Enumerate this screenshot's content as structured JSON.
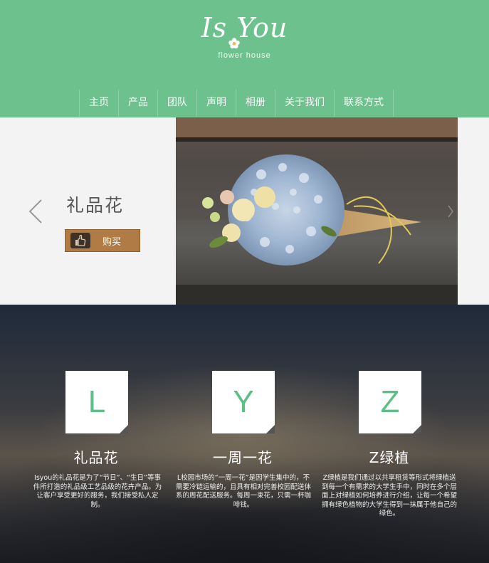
{
  "header": {
    "logo_text": "Is You",
    "logo_sub": "flower  house",
    "nav": [
      "主页",
      "产品",
      "团队",
      "声明",
      "相册",
      "关于我们",
      "联系方式"
    ]
  },
  "banner": {
    "title": "礼品花",
    "buy_label": "购买"
  },
  "features": [
    {
      "letter": "L",
      "title": "礼品花",
      "desc": "Isyou的礼品花是为了“节日”、“生日”等事件所打造的礼品级工艺品级的花卉产品。为让客户享受更好的服务，我们接受私人定制。"
    },
    {
      "letter": "Y",
      "title": "一周一花",
      "desc": "L校园市场的“一周一花”是因学生集中的，不需要冷链运输的，且具有相对完善校园配送体系的周花配送服务。每周一束花，只需一杯咖啡钱。"
    },
    {
      "letter": "Z",
      "title": "Z绿植",
      "desc": "Z绿植是我们通过以共享租赁等形式将绿植送到每一个有需求的大学生手中，同时在多个层面上对绿植如何培养进行介绍，让每一个希望拥有绿色植物的大学生得到一抹属于他自己的绿色。"
    }
  ],
  "colors": {
    "brand_green": "#6cc18c",
    "buy_brown": "#b07b45",
    "tile_letter": "#5cbf86"
  },
  "icons": [
    "flower-icon",
    "chevron-left-icon",
    "chevron-right-icon",
    "hand-cursor-icon"
  ]
}
